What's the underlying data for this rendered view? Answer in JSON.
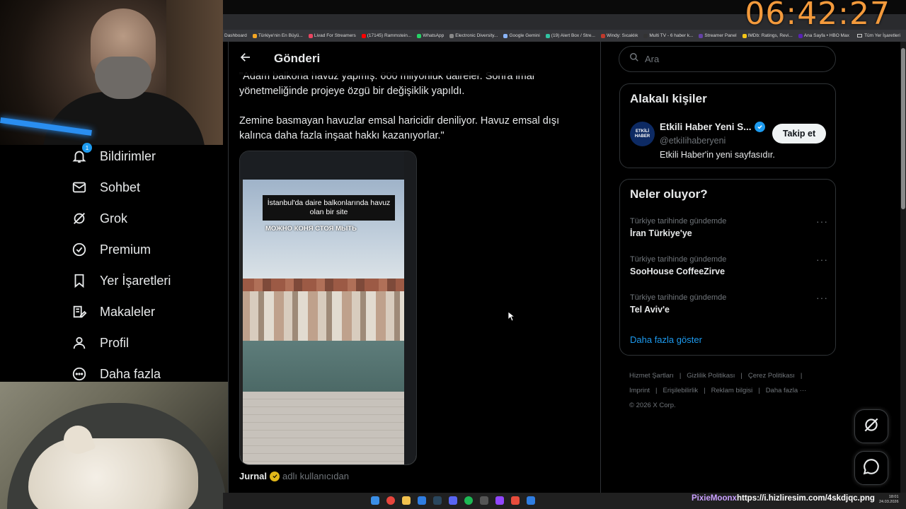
{
  "overlay": {
    "clock": "06:42:27"
  },
  "bookmarks": {
    "items": [
      {
        "label": "Dashboard",
        "color": "#4a4a4a"
      },
      {
        "label": "Türkiye'nin En Büyü...",
        "color": "#f5a623"
      },
      {
        "label": "Livad For Streamers",
        "color": "#e94560"
      },
      {
        "label": "(17145) Rammstein...",
        "color": "#ff0000"
      },
      {
        "label": "WhatsApp",
        "color": "#25d366"
      },
      {
        "label": "Electronic Diversity...",
        "color": "#888888"
      },
      {
        "label": "Google Gemini",
        "color": "#8ab4f8"
      },
      {
        "label": "(19) Alert Box / Stre...",
        "color": "#31c3a2"
      },
      {
        "label": "Windy: Sıcaklık",
        "color": "#c0392b"
      },
      {
        "label": "Multi TV - 6 haber k...",
        "color": "#333333"
      },
      {
        "label": "Streamer Panel",
        "color": "#6441a5"
      },
      {
        "label": "IMDb: Ratings, Revi...",
        "color": "#f5c518"
      },
      {
        "label": "Ana Sayfa • HBO Max",
        "color": "#5822b4"
      }
    ],
    "all_bookmarks": "Tüm Yer İşaretleri"
  },
  "nav": {
    "notifications": {
      "label": "Bildirimler",
      "badge": "1"
    },
    "messages": {
      "label": "Sohbet"
    },
    "grok": {
      "label": "Grok"
    },
    "premium": {
      "label": "Premium"
    },
    "bookmarks": {
      "label": "Yer İşaretleri"
    },
    "articles": {
      "label": "Makaleler"
    },
    "profile": {
      "label": "Profil"
    },
    "more": {
      "label": "Daha fazla"
    }
  },
  "main": {
    "title": "Gönderi",
    "text_line1": "\"Adam balkona havuz yapmış. 600 milyonluk daireler. Sonra imar",
    "text_line2": "yönetmeliğinde projeye özgü bir değişiklik yapıldı.",
    "text_line3": "Zemine basmayan havuzlar emsal haricidir deniliyor. Havuz emsal dışı",
    "text_line4": "kalınca daha fazla inşaat hakkı kazanıyorlar.\"",
    "media": {
      "caption": "İstanbul'da daire balkonlarında havuz olan bir site",
      "overlay_text": "МОЖНО КОНЯ СТОЯ МЫТЬ"
    },
    "attribution": {
      "name": "Jurnal",
      "suffix": "adlı kullanıcıdan"
    }
  },
  "sidebar": {
    "search_placeholder": "Ara",
    "related": {
      "title": "Alakalı kişiler",
      "person": {
        "avatar_text": "ETKİLİ HABER",
        "name": "Etkili Haber Yeni S...",
        "handle": "@etkiIihaberyeni",
        "bio": "Etkili Haber'in yeni sayfasıdır.",
        "follow": "Takip et"
      }
    },
    "trends": {
      "title": "Neler oluyor?",
      "items": [
        {
          "category": "Türkiye tarihinde gündemde",
          "name": "İran Türkiye'ye"
        },
        {
          "category": "Türkiye tarihinde gündemde",
          "name": "SooHouse CoffeeZirve"
        },
        {
          "category": "Türkiye tarihinde gündemde",
          "name": "Tel Aviv'e"
        }
      ],
      "show_more": "Daha fazla göster"
    },
    "footer": {
      "links": [
        "Hizmet Şartları",
        "|",
        "Gizlilik Politikası",
        "|",
        "Çerez Politikası",
        "|"
      ],
      "links2": [
        "Imprint",
        "|",
        "Erişilebilirlik",
        "|",
        "Reklam bilgisi",
        "|",
        "Daha fazla ···"
      ],
      "copyright": "© 2026 X Corp."
    }
  },
  "taskbar": {
    "stream_user": "PixieMoonx",
    "stream_link": "https://i.hizliresim.com/4skdjqc.png",
    "time": "18:01",
    "date": "24.03.2026"
  },
  "colors": {
    "accent": "#1d9bf0",
    "clock": "#f39a3c",
    "background": "#000000"
  }
}
